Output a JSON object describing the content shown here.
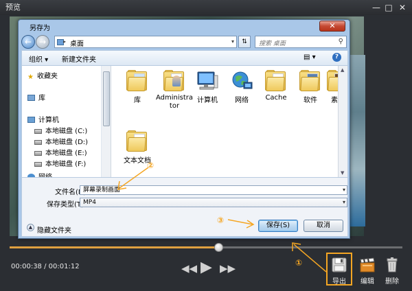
{
  "app": {
    "title": "预览",
    "minimize": "—",
    "maximize": "□",
    "close": "✕"
  },
  "player": {
    "time": "00:00:38 / 00:01:12",
    "progress": 0.534,
    "tools": {
      "export": "导出",
      "edit": "编辑",
      "delete": "删除"
    }
  },
  "dialog": {
    "title": "另存为",
    "close": "✕",
    "address": "桌面",
    "search_placeholder": "搜索 桌面",
    "toolbar": {
      "organize": "组织 ▾",
      "new_folder": "新建文件夹"
    },
    "sidebar": [
      {
        "label": "收藏夹",
        "icon": "star-icon"
      },
      {
        "label": "库",
        "icon": "library-icon"
      },
      {
        "label": "计算机",
        "icon": "computer-icon"
      },
      {
        "label": "本地磁盘 (C:)",
        "icon": "disk-icon"
      },
      {
        "label": "本地磁盘 (D:)",
        "icon": "disk-icon"
      },
      {
        "label": "本地磁盘 (E:)",
        "icon": "disk-icon"
      },
      {
        "label": "本地磁盘 (F:)",
        "icon": "disk-icon"
      },
      {
        "label": "网络",
        "icon": "network-icon"
      }
    ],
    "files": [
      {
        "label": "库",
        "icon": "library-folder-icon"
      },
      {
        "label": "Administrator",
        "icon": "user-folder-icon"
      },
      {
        "label": "计算机",
        "icon": "computer-icon"
      },
      {
        "label": "网络",
        "icon": "network-globe-icon"
      },
      {
        "label": "Cache",
        "icon": "folder-icon"
      },
      {
        "label": "软件",
        "icon": "folder-icon"
      },
      {
        "label": "素材",
        "icon": "folder-icon"
      },
      {
        "label": "文本文档",
        "icon": "folder-icon"
      }
    ],
    "filename_label": "文件名(N):",
    "filename_value": "屏幕录制画面",
    "filetype_label": "保存类型(T):",
    "filetype_value": "MP4",
    "hide_folders": "隐藏文件夹",
    "save": "保存(S)",
    "cancel": "取消"
  },
  "annotations": {
    "step1": "①",
    "step2": "②",
    "step3": "③",
    "color": "#f5a623"
  }
}
